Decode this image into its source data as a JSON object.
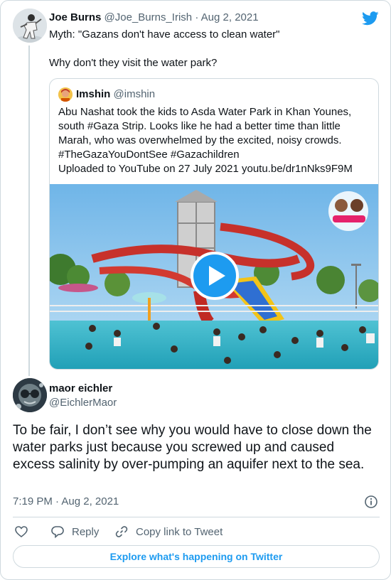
{
  "parent_tweet": {
    "name": "Joe Burns",
    "handle": "@Joe_Burns_Irish",
    "date": "· Aug 2, 2021",
    "text": "Myth: \"Gazans don't have access to clean water\"\n\nWhy don't they visit the water park?"
  },
  "quoted_tweet": {
    "name": "Imshin",
    "handle": "@imshin",
    "text": "Abu Nashat took the kids to Asda Water Park in Khan Younes, south #Gaza Strip. Looks like he had a better time than little Marah, who was overwhelmed by the excited, noisy crowds.\n#TheGazaYouDontSee #Gazachildren\nUploaded to YouTube on 27 July 2021 youtu.be/dr1nNks9F9M"
  },
  "main_tweet": {
    "name": "maor eichler",
    "handle": "@EichlerMaor",
    "text": "To be fair, I don’t see why you would have to close down the water parks just because you screwed up and caused excess salinity by over-pumping an aquifer next to the sea.",
    "timestamp": "7:19 PM · Aug 2, 2021"
  },
  "actions": {
    "reply_label": "Reply",
    "copy_link_label": "Copy link to Tweet"
  },
  "explore_label": "Explore what's happening on Twitter",
  "colors": {
    "accent": "#1d9bf0",
    "text": "#0f1419",
    "secondary": "#536471",
    "border": "#cfd9de"
  },
  "icons": [
    "twitter-bird-icon",
    "play-icon",
    "info-icon",
    "heart-icon",
    "reply-icon",
    "link-icon"
  ]
}
